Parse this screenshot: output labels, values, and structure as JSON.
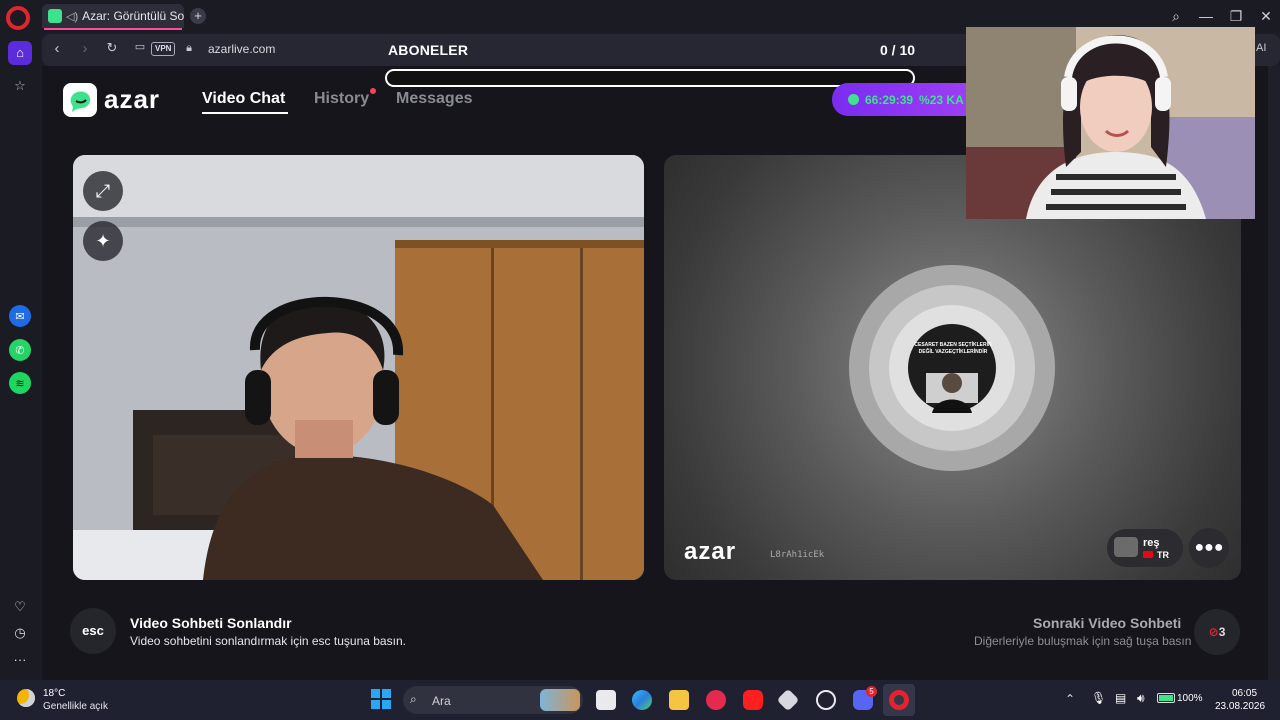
{
  "browser": {
    "tab_title": "Azar: Görüntülü Sohbe",
    "url": "azarlive.com",
    "vpn_label": "VPN",
    "ai_label": "AI",
    "new_tab_label": "+"
  },
  "overlay": {
    "subs_title": "ABONELER",
    "subs_count": "0 / 10",
    "subs_progress": 0
  },
  "header": {
    "logo_text": "azar",
    "nav": {
      "video_chat": "Video Chat",
      "history": "History",
      "messages": "Messages"
    },
    "timer": {
      "time": "66:29:39",
      "discount": "%23 KA"
    }
  },
  "remote": {
    "logo_text": "azar",
    "username": "L8rAh1icEk",
    "peer_name": "reş",
    "peer_country": "TR",
    "avatar_caption": "CESARET BAZEN SEÇTİKLERİN DEĞİL VAZGEÇTİKLERİNDİR"
  },
  "bottom": {
    "esc_label": "esc",
    "end_title": "Video Sohbeti Sonlandır",
    "end_desc": "Video sohbetini sonlandırmak için esc tuşuna basın.",
    "next_title": "Sonraki Video Sohbeti",
    "next_desc": "Diğerleriyle buluşmak için sağ tuşa basın",
    "next_count": "3"
  },
  "taskbar": {
    "temperature": "18°C",
    "weather": "Genellikle açık",
    "search_placeholder": "Ara",
    "battery": "100%",
    "time": "06:05",
    "date": "23.08.2026",
    "discord_badge": "5"
  },
  "colors": {
    "accent_green": "#3ee38e",
    "promo_purple": "#8a36f2",
    "opera_red": "#e0252f"
  }
}
